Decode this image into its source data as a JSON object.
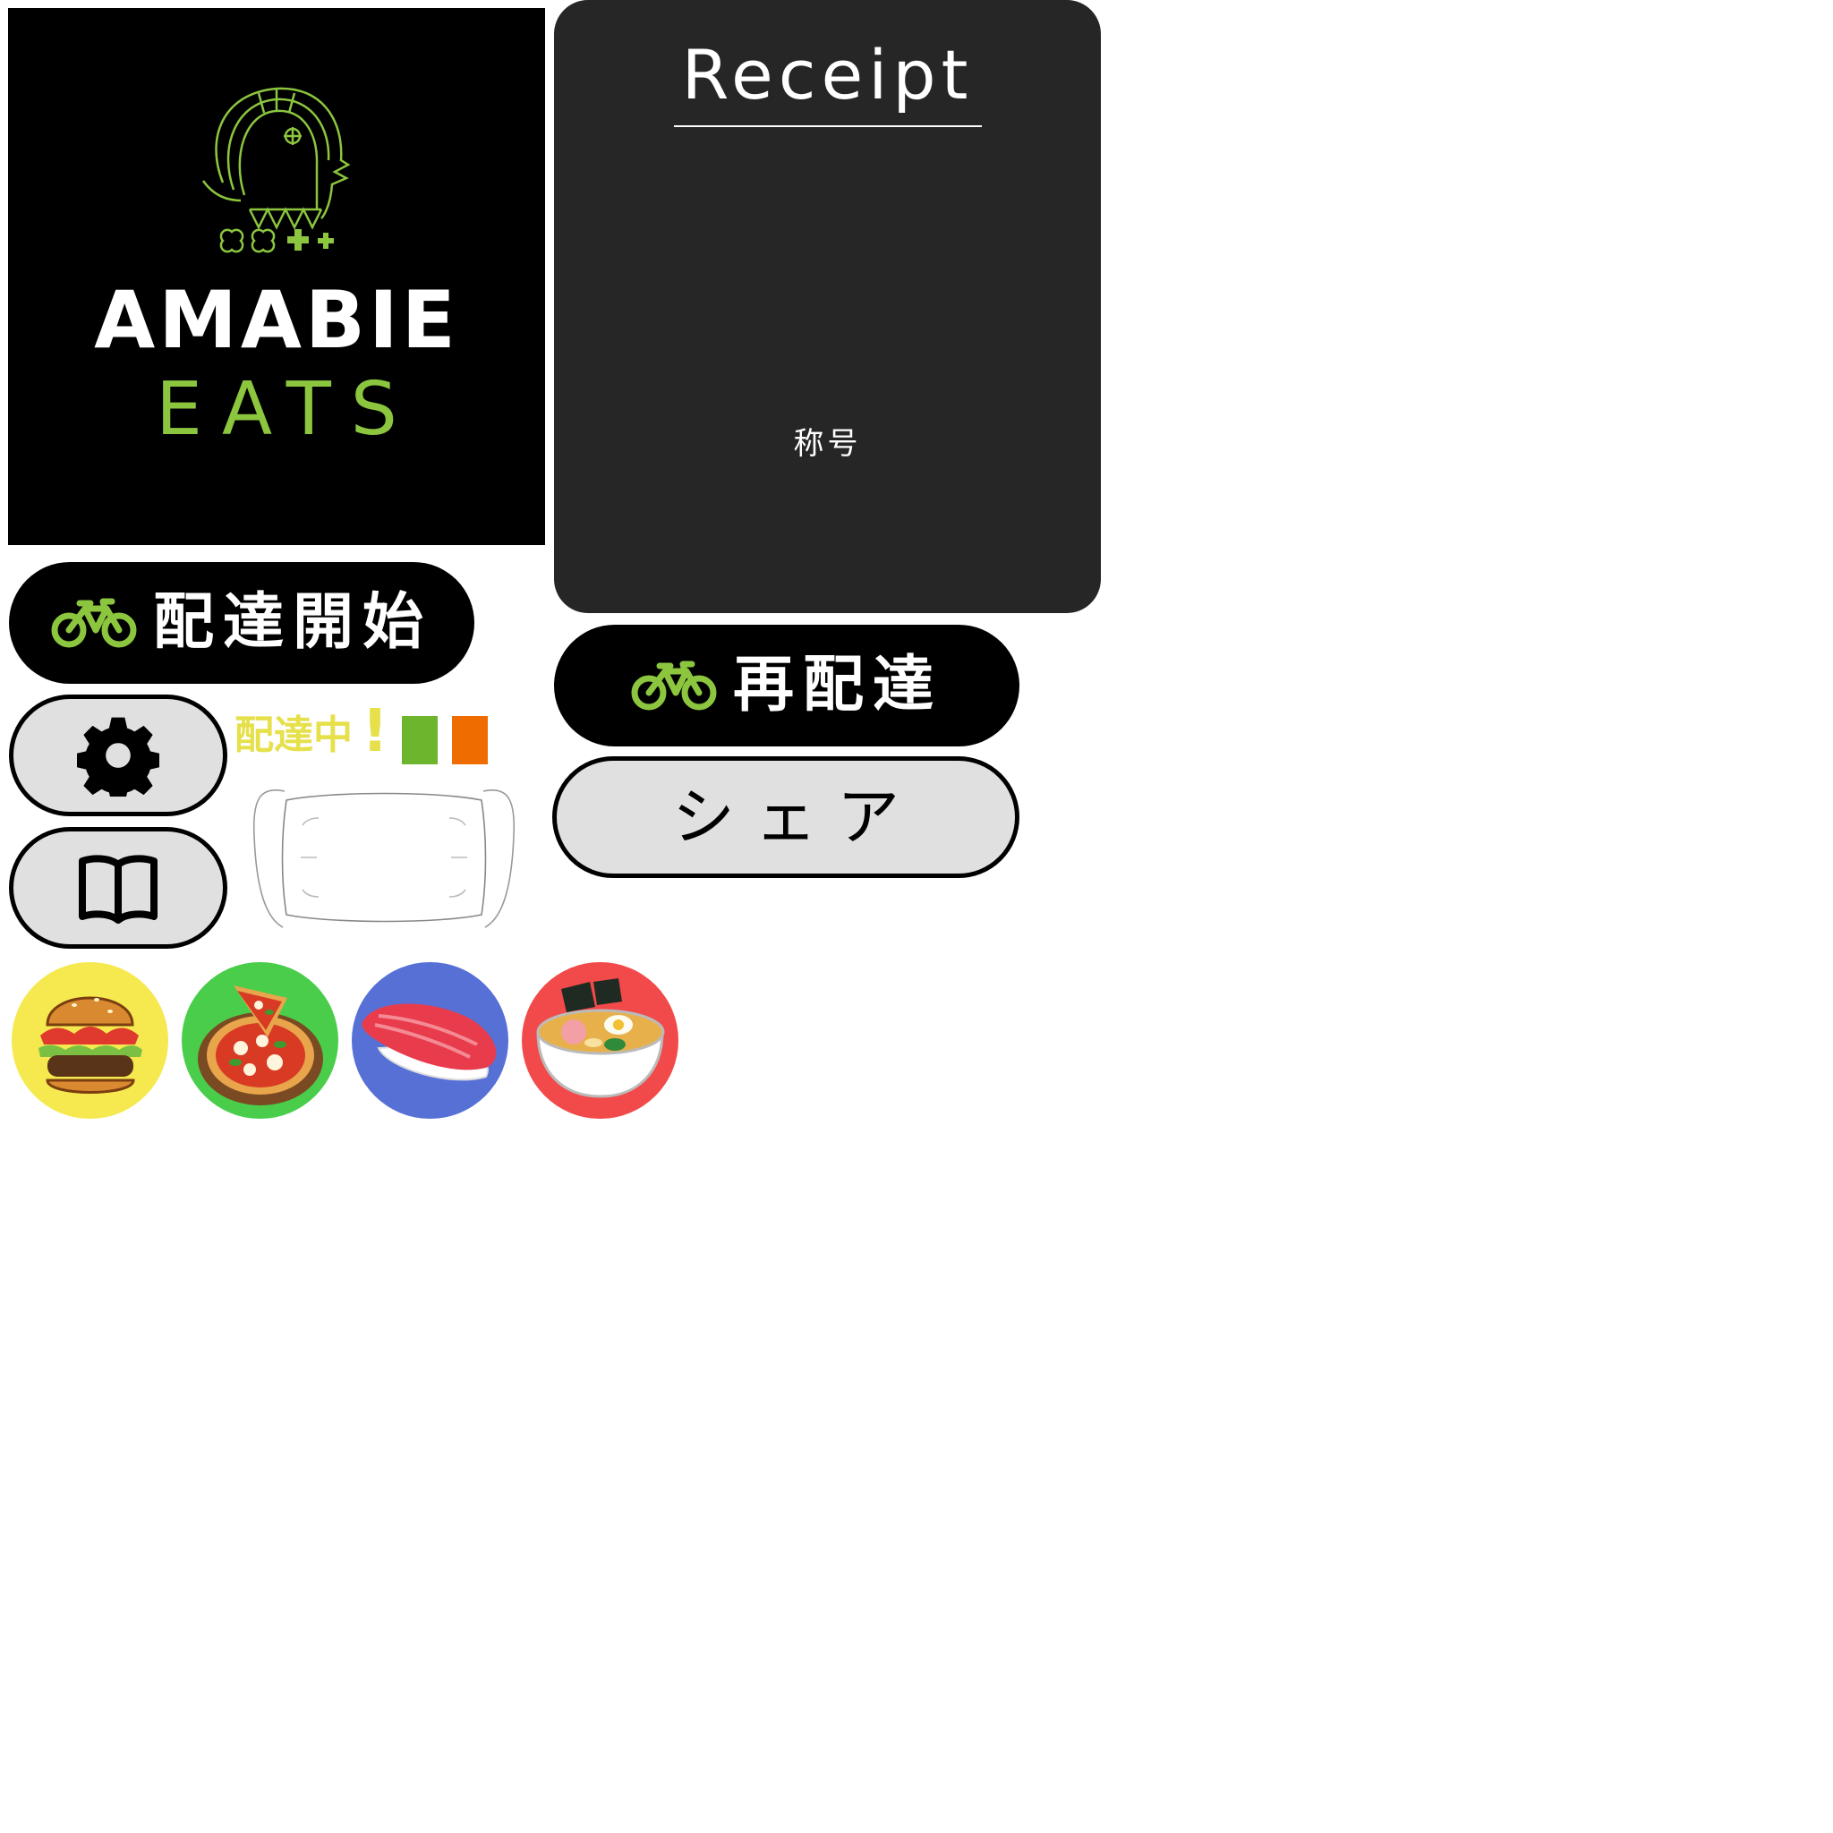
{
  "logo": {
    "line1": "AMABIE",
    "line2": "EATS",
    "mark_icon": "amabie-mark-icon",
    "accent": "#8cc63f"
  },
  "receipt": {
    "title": "Receipt",
    "caption": "称号",
    "background": "#262626"
  },
  "buttons": {
    "start_delivery": "配達開始",
    "redeliver": "再配達",
    "share": "シェア",
    "settings_icon": "gear-icon",
    "guide_icon": "book-icon",
    "bike_icon": "bicycle-icon"
  },
  "status": {
    "label": "配達中",
    "exclaim": "!",
    "colors": [
      "#6cb52d",
      "#ef6c00"
    ],
    "text_color": "#e6e04a"
  },
  "foods": [
    {
      "icon": "hamburger-icon",
      "color": "#f5e94f"
    },
    {
      "icon": "pizza-icon",
      "color": "#49cd4a"
    },
    {
      "icon": "sushi-icon",
      "color": "#5670d6"
    },
    {
      "icon": "ramen-icon",
      "color": "#f24a4a"
    }
  ]
}
